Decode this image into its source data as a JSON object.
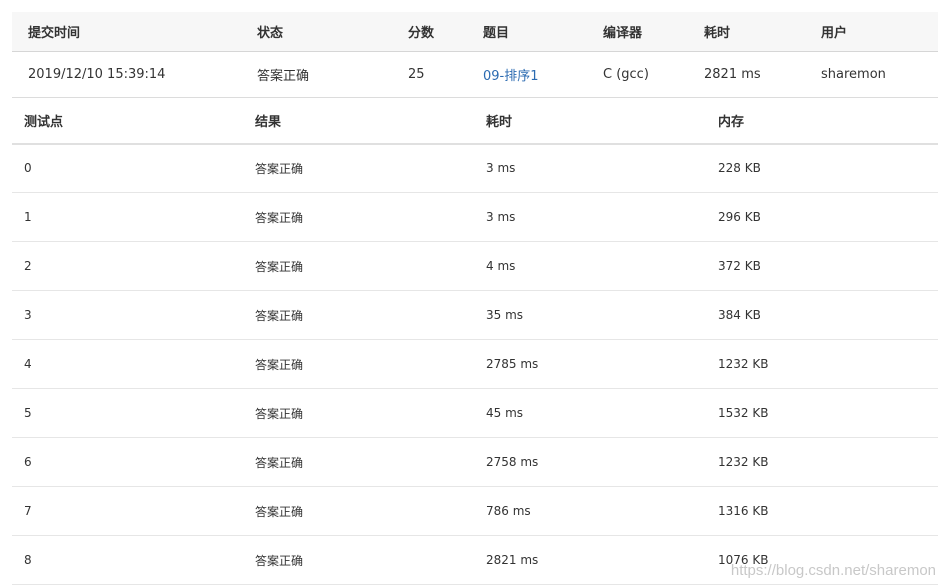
{
  "summary": {
    "headers": [
      "提交时间",
      "状态",
      "分数",
      "题目",
      "编译器",
      "耗时",
      "用户"
    ],
    "row": {
      "time": "2019/12/10 15:39:14",
      "status": "答案正确",
      "score": "25",
      "problem": "09-排序1",
      "compiler": "C (gcc)",
      "elapsed": "2821 ms",
      "user": "sharemon"
    }
  },
  "cases": {
    "headers": [
      "测试点",
      "结果",
      "耗时",
      "内存"
    ],
    "rows": [
      {
        "id": "0",
        "result": "答案正确",
        "time": "3 ms",
        "memory": "228 KB"
      },
      {
        "id": "1",
        "result": "答案正确",
        "time": "3 ms",
        "memory": "296 KB"
      },
      {
        "id": "2",
        "result": "答案正确",
        "time": "4 ms",
        "memory": "372 KB"
      },
      {
        "id": "3",
        "result": "答案正确",
        "time": "35 ms",
        "memory": "384 KB"
      },
      {
        "id": "4",
        "result": "答案正确",
        "time": "2785 ms",
        "memory": "1232 KB"
      },
      {
        "id": "5",
        "result": "答案正确",
        "time": "45 ms",
        "memory": "1532 KB"
      },
      {
        "id": "6",
        "result": "答案正确",
        "time": "2758 ms",
        "memory": "1232 KB"
      },
      {
        "id": "7",
        "result": "答案正确",
        "time": "786 ms",
        "memory": "1316 KB"
      },
      {
        "id": "8",
        "result": "答案正确",
        "time": "2821 ms",
        "memory": "1076 KB"
      }
    ]
  },
  "watermark": "https://blog.csdn.net/sharemon",
  "colors": {
    "accepted": "#e0352b",
    "link": "#2a6ab1",
    "header_bg": "#f7f7f7"
  }
}
